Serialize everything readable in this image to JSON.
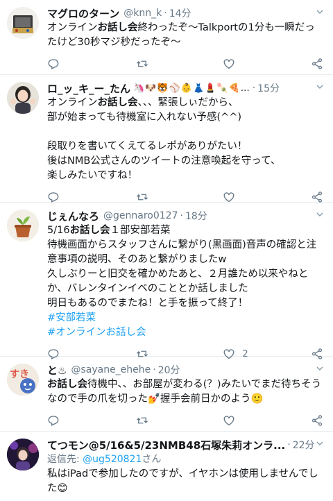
{
  "tweets": [
    {
      "name": "マグロのターン",
      "emojis": "",
      "handle": "@knn_k",
      "time": "14分",
      "lines": [
        {
          "pre": "オンライン",
          "bold": "お話し会",
          "post": "終わったぞ〜Talkportの1分も一瞬だったけど30秒マジ秒だったぞ〜"
        }
      ],
      "hashtags": [],
      "reply_to": null,
      "counts": {
        "reply": "",
        "retweet": "",
        "like": ""
      }
    },
    {
      "name": "ロ_ッ_キ_ー_たん",
      "emojis": "🦄🐶🐯⚾👶👗💄🍡🍕…",
      "handle": "",
      "time": "15分",
      "lines": [
        {
          "pre": "オンライン",
          "bold": "お話し会",
          "post": "、、、緊張しぃだから、\n部が始まっても待機室に入れない予感(^^)\n\n段取りを書いてくえてるレポがありがたい！\n後はNMB公式さんのツイートの注意喚起を守って、\n楽しみたいですね！"
        }
      ],
      "hashtags": [],
      "reply_to": null,
      "counts": {
        "reply": "",
        "retweet": "",
        "like": ""
      }
    },
    {
      "name": "じぇんなろ",
      "emojis": "",
      "handle": "@gennaro0127",
      "time": "18分",
      "lines": [
        {
          "pre": "5/16",
          "bold": "お話し会",
          "post": "１部安部若菜\n待機画面からスタッフさんに繋がり(黒画面)音声の確認と注意事項の説明、そのあと繋がりましたw\n久しぶりーと旧交を確かめたあと、２月誰ため以来やねとか、バレンタインイベのこととか話しました\n明日もあるのでまたね！と手を振って終了！"
        }
      ],
      "hashtags": [
        "#安部若菜",
        "#オンラインお話し会"
      ],
      "reply_to": null,
      "counts": {
        "reply": "",
        "retweet": "",
        "like": "2"
      }
    },
    {
      "name": "と♨",
      "emojis": "",
      "handle": "@sayane_ehehe",
      "time": "20分",
      "lines": [
        {
          "pre": "",
          "bold": "お話し会",
          "post": "待機中、、お部屋が変わる(？)みたいでまだ待ちそうなので手の爪を切った💅握手会前日かのよう🙂"
        }
      ],
      "hashtags": [],
      "reply_to": null,
      "counts": {
        "reply": "",
        "retweet": "",
        "like": ""
      }
    },
    {
      "name": "てつモン@5/16&5/23NMB48石塚朱莉オンラ...",
      "emojis": "",
      "handle": "",
      "time": "22分",
      "lines": [
        {
          "pre": "",
          "bold": "",
          "post": "私はiPadで参加したのですが、イヤホンは使用しませんでした😊"
        }
      ],
      "hashtags": [],
      "reply_to": {
        "prefix": "返信先: ",
        "mention": "@ug520821",
        "suffix": "さん"
      },
      "counts": {
        "reply": "",
        "retweet": "",
        "like": ""
      }
    }
  ],
  "colors": {
    "link": "#1da1f2",
    "muted": "#657786",
    "divider": "#e6ecf0"
  },
  "icons": [
    "reply-icon",
    "retweet-icon",
    "like-icon",
    "share-icon",
    "caret-down-icon"
  ]
}
